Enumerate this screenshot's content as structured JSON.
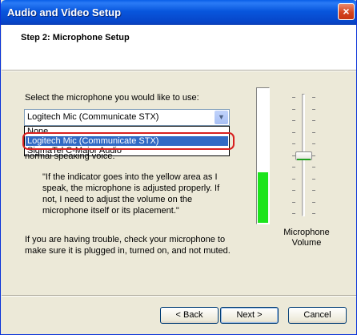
{
  "window": {
    "title": "Audio and Video Setup",
    "close_label": "×"
  },
  "header": {
    "step_title": "Step 2: Microphone Setup"
  },
  "content": {
    "select_label": "Select the microphone you would like to use:",
    "selected_mic": "Logitech Mic (Communicate STX)",
    "options": [
      "None",
      "Logitech Mic (Communicate STX)",
      "SigmaTel C-Major Audio"
    ],
    "partial_text": "normal speaking voice.",
    "quote": "\"If the indicator goes into the yellow area as I speak, the microphone is adjusted properly.  If not, I need to adjust the volume on the microphone itself or its placement.\"",
    "help_text": "If you are having trouble, check your microphone to make sure it is plugged in, turned on, and not muted."
  },
  "meter": {
    "level_fraction": 0.38,
    "color": "#1ce41c"
  },
  "volume": {
    "label": "Microphone Volume",
    "level_fraction": 0.5
  },
  "buttons": {
    "back": "< Back",
    "next": "Next >",
    "cancel": "Cancel"
  }
}
